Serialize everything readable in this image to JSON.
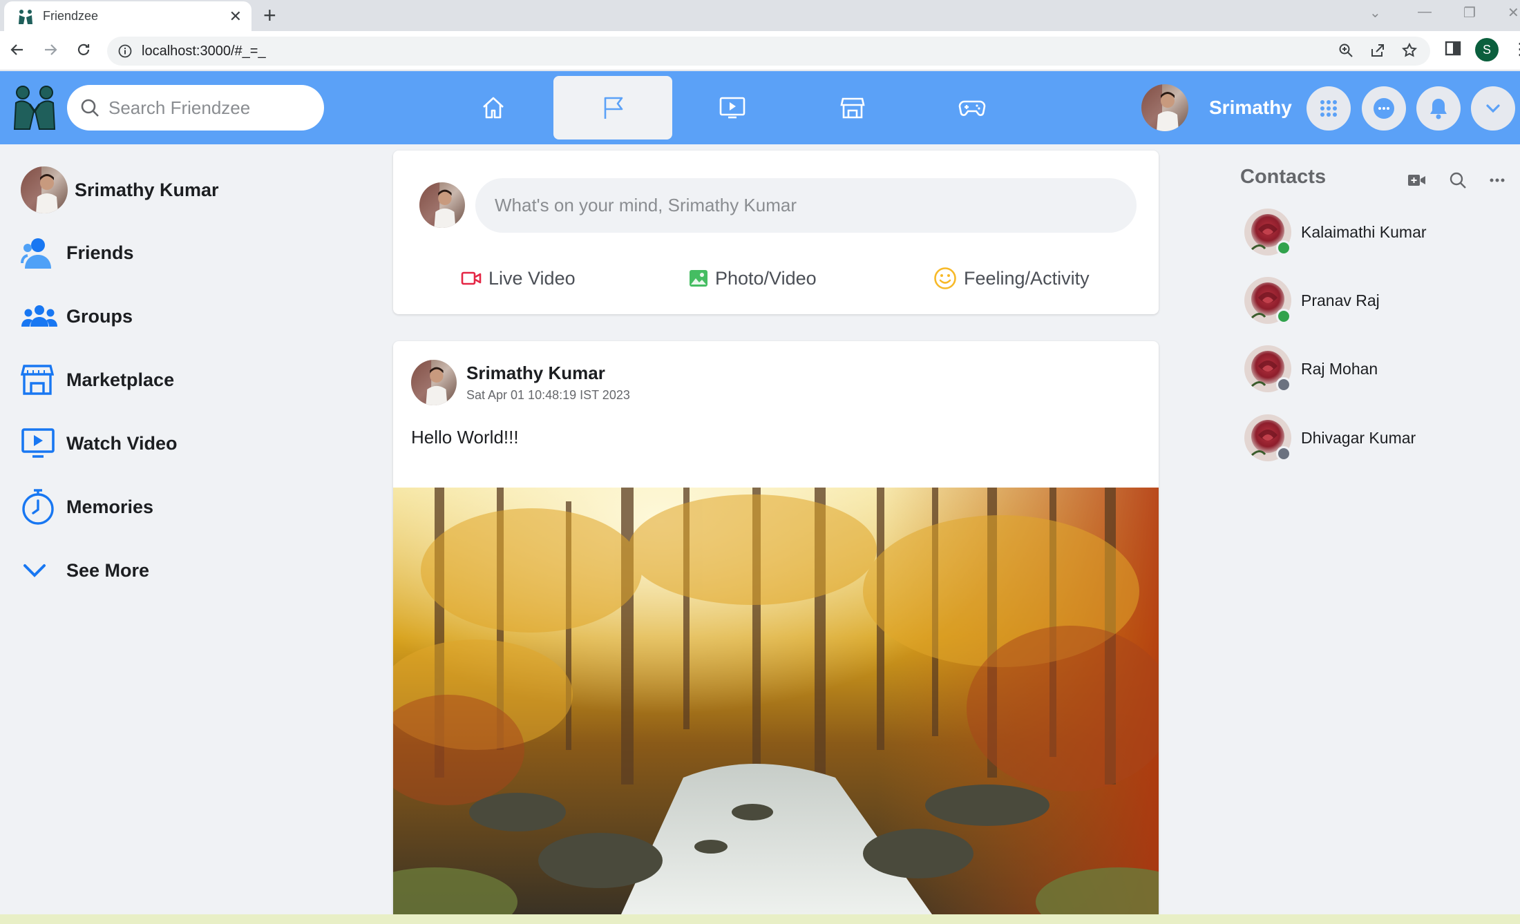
{
  "browser": {
    "tab_title": "Friendzee",
    "url": "localhost:3000/#_=_",
    "profile_initial": "S"
  },
  "header": {
    "search_placeholder": "Search Friendzee",
    "user_name": "Srimathy",
    "nav_tabs": [
      "home",
      "pages",
      "watch",
      "marketplace",
      "gaming"
    ],
    "active_tab": "pages",
    "accent_color": "#5ba1f7"
  },
  "sidebar": {
    "items": [
      {
        "label": "Srimathy Kumar",
        "icon": "avatar"
      },
      {
        "label": "Friends",
        "icon": "friends-icon"
      },
      {
        "label": "Groups",
        "icon": "groups-icon"
      },
      {
        "label": "Marketplace",
        "icon": "store-icon"
      },
      {
        "label": "Watch Video",
        "icon": "video-icon"
      },
      {
        "label": "Memories",
        "icon": "clock-icon"
      },
      {
        "label": "See More",
        "icon": "chevron-down-icon"
      }
    ]
  },
  "composer": {
    "placeholder": "What's on your mind, Srimathy Kumar",
    "actions": [
      {
        "label": "Live Video",
        "icon": "live-video-icon",
        "color": "#e42645"
      },
      {
        "label": "Photo/Video",
        "icon": "photo-icon",
        "color": "#45bd62"
      },
      {
        "label": "Feeling/Activity",
        "icon": "smile-icon",
        "color": "#f7b928"
      }
    ]
  },
  "post": {
    "author": "Srimathy Kumar",
    "timestamp": "Sat Apr 01 10:48:19 IST 2023",
    "text": "Hello World!!!",
    "image": "autumn-forest-stream"
  },
  "contacts": {
    "title": "Contacts",
    "list": [
      {
        "name": "Kalaimathi Kumar",
        "online": true
      },
      {
        "name": "Pranav Raj",
        "online": true
      },
      {
        "name": "Raj Mohan",
        "online": false
      },
      {
        "name": "Dhivagar Kumar",
        "online": false
      }
    ],
    "online_color": "#31a24c",
    "offline_color": "#6b7280"
  }
}
